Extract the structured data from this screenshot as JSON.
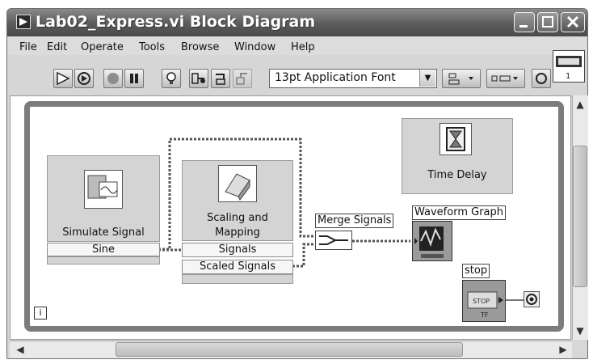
{
  "window": {
    "title": "Lab02_Express.vi Block Diagram"
  },
  "menu": {
    "items": [
      "File",
      "Edit",
      "Operate",
      "Tools",
      "Browse",
      "Window",
      "Help"
    ]
  },
  "toolbar": {
    "font": "13pt Application Font",
    "buttons": [
      "run-arrow-icon",
      "run-continuously-icon",
      "abort-icon",
      "pause-icon",
      "highlight-execution-icon",
      "retain-wire-values-icon",
      "step-into-icon",
      "step-over-icon",
      "step-out-icon"
    ]
  },
  "diagram": {
    "simulate": {
      "title": "Simulate Signal",
      "output": "Sine"
    },
    "scaling": {
      "title_line1": "Scaling and",
      "title_line2": "Mapping",
      "input": "Signals",
      "output": "Scaled Signals"
    },
    "merge": {
      "label": "Merge Signals"
    },
    "graph": {
      "label": "Waveform Graph"
    },
    "time_delay": {
      "title": "Time Delay"
    },
    "stop": {
      "label": "stop",
      "button_text": "STOP",
      "tf": "TF"
    },
    "loop_index": "i"
  },
  "colors": {
    "wire": "#6b6b6b",
    "loop_border": "#7c7c7c",
    "titlebar": "#5b5b5b"
  }
}
